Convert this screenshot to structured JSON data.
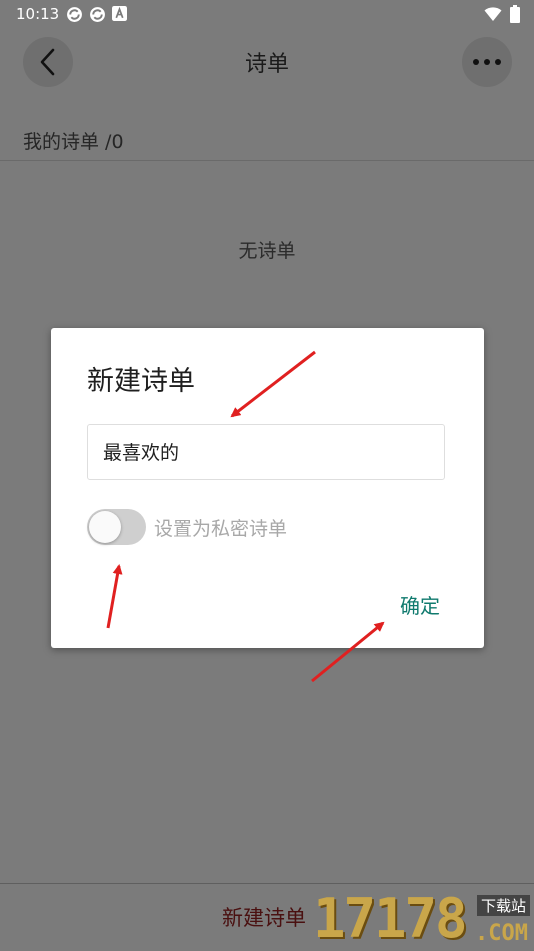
{
  "status_bar": {
    "time": "10:13",
    "icons": [
      "sync-icon",
      "sync-icon",
      "font-app-icon"
    ],
    "right_icons": [
      "wifi-icon",
      "battery-icon"
    ]
  },
  "header": {
    "title": "诗单",
    "back_icon": "chevron-left-icon",
    "more_icon": "more-dots-icon"
  },
  "section": {
    "label": "我的诗单 /0"
  },
  "empty_state": {
    "text": "无诗单"
  },
  "dialog": {
    "title": "新建诗单",
    "input_value": "最喜欢的",
    "toggle_label": "设置为私密诗单",
    "toggle_on": false,
    "confirm_label": "确定"
  },
  "bottom_bar": {
    "new_list_label": "新建诗单"
  },
  "watermark": {
    "digits": "17178",
    "site": "下载站",
    "com": ".COM"
  },
  "colors": {
    "accent": "#107a6e",
    "annotation_arrow": "#e02020",
    "overlay_background": "#7b7b7b"
  }
}
